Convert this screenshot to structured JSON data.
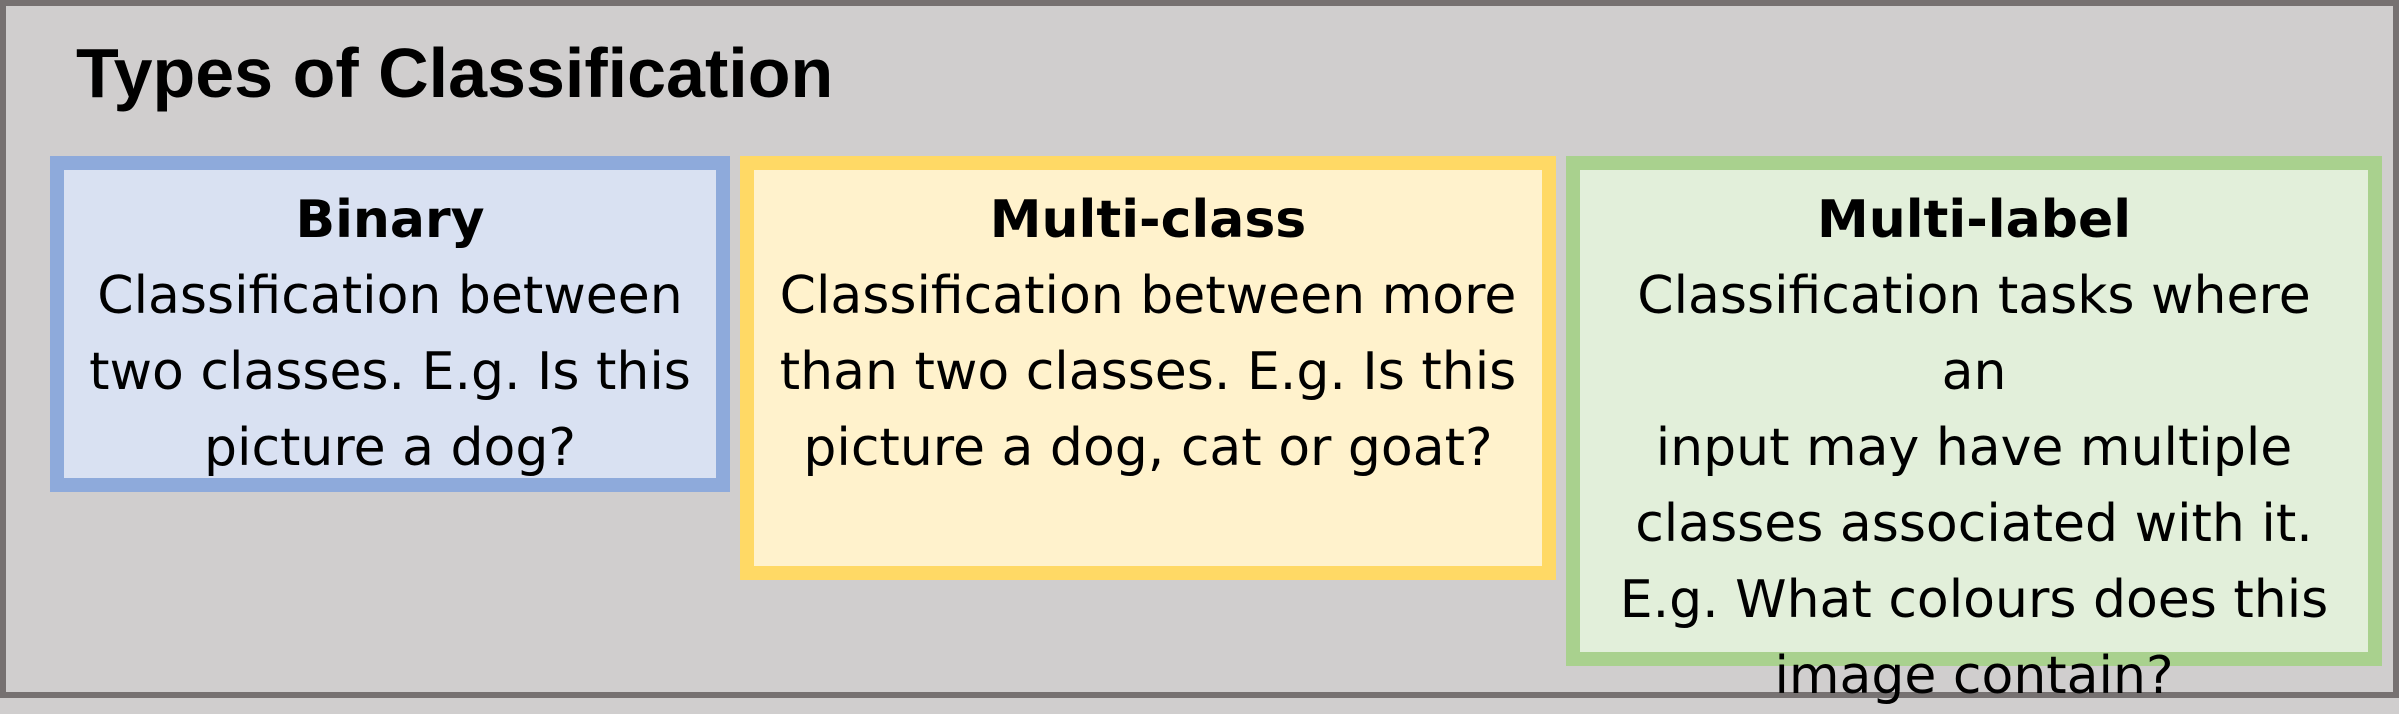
{
  "title": "Types of Classification",
  "cards": [
    {
      "heading": "Binary",
      "lines": [
        "Classification between",
        "two classes. E.g. Is this",
        "picture a dog?"
      ],
      "border_color": "#8eaadb",
      "fill_color": "#d9e1f2"
    },
    {
      "heading": "Multi-class",
      "lines": [
        "Classification between more",
        "than two classes. E.g. Is this",
        "picture a dog, cat or goat?"
      ],
      "border_color": "#ffd965",
      "fill_color": "#fff2cc"
    },
    {
      "heading": "Multi-label",
      "lines": [
        "Classification tasks where an",
        "input may have multiple",
        "classes associated with it.",
        "E.g. What colours does this",
        "image contain?"
      ],
      "border_color": "#a9d18e",
      "fill_color": "#e2efda"
    }
  ]
}
